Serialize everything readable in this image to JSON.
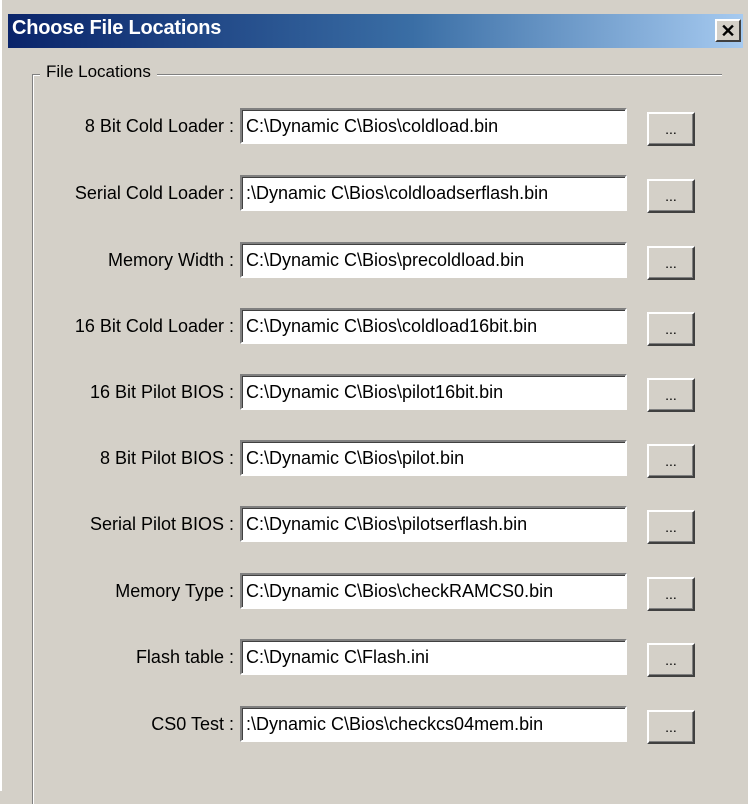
{
  "window": {
    "title": "Choose File Locations",
    "close_label": "✕"
  },
  "group": {
    "label": "File Locations"
  },
  "rows": [
    {
      "label": "8 Bit Cold Loader :",
      "value": "C:\\Dynamic C\\Bios\\coldload.bin",
      "button": "..."
    },
    {
      "label": "Serial Cold Loader :",
      "value": ":\\Dynamic C\\Bios\\coldloadserflash.bin",
      "button": "..."
    },
    {
      "label": "Memory Width :",
      "value": "C:\\Dynamic C\\Bios\\precoldload.bin",
      "button": "..."
    },
    {
      "label": "16 Bit Cold Loader :",
      "value": "C:\\Dynamic C\\Bios\\coldload16bit.bin",
      "button": "..."
    },
    {
      "label": "16 Bit Pilot BIOS :",
      "value": "C:\\Dynamic C\\Bios\\pilot16bit.bin",
      "button": "..."
    },
    {
      "label": "8 Bit Pilot BIOS :",
      "value": "C:\\Dynamic C\\Bios\\pilot.bin",
      "button": "..."
    },
    {
      "label": "Serial Pilot BIOS :",
      "value": "C:\\Dynamic C\\Bios\\pilotserflash.bin",
      "button": "..."
    },
    {
      "label": "Memory Type :",
      "value": "C:\\Dynamic C\\Bios\\checkRAMCS0.bin",
      "button": "..."
    },
    {
      "label": "Flash table :",
      "value": "C:\\Dynamic C\\Flash.ini",
      "button": "..."
    },
    {
      "label": "CS0 Test :",
      "value": ":\\Dynamic C\\Bios\\checkcs04mem.bin",
      "button": "..."
    }
  ]
}
